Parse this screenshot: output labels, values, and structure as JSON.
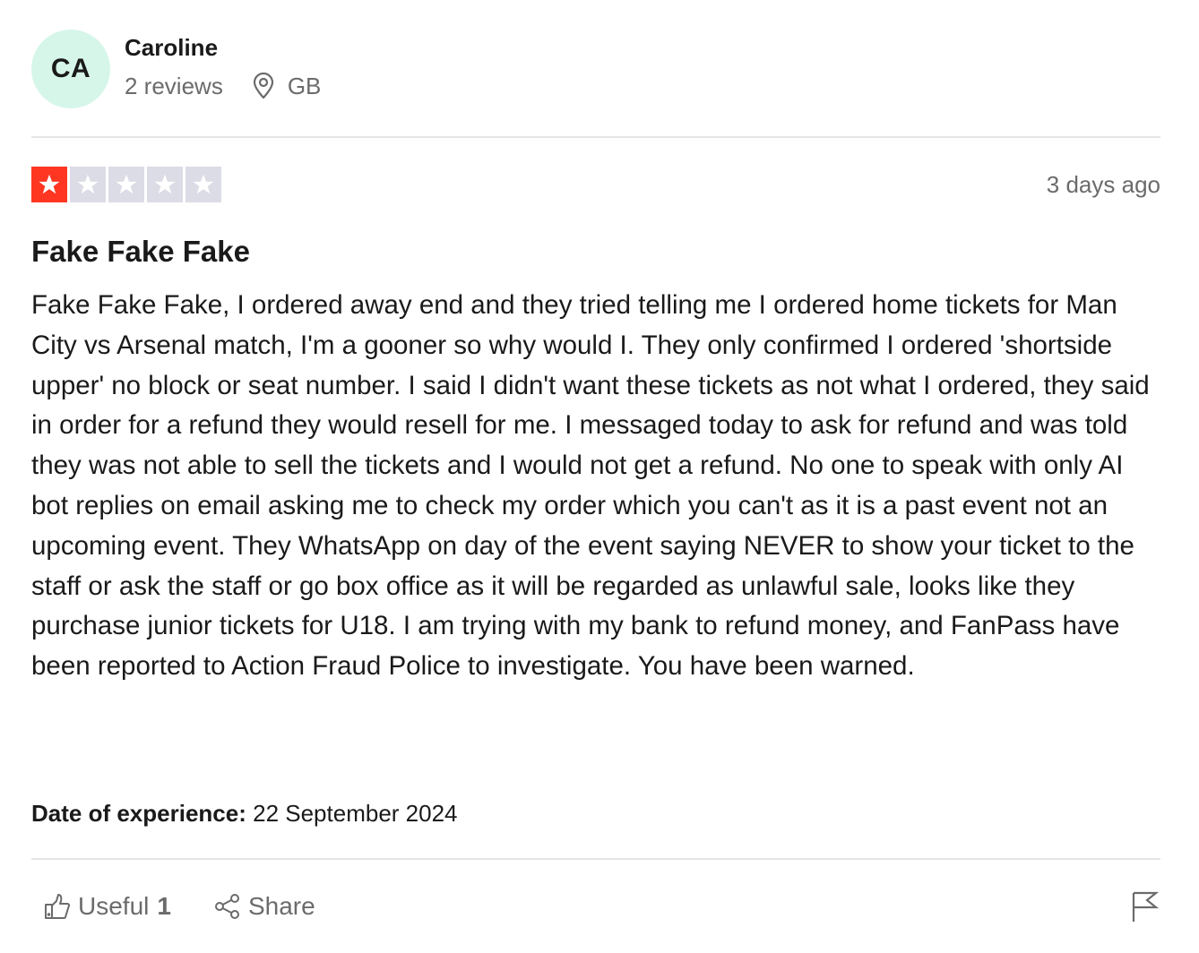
{
  "consumer": {
    "initials": "CA",
    "name": "Caroline",
    "reviews_count": "2 reviews",
    "location": "GB",
    "location_icon": "map-pin-icon"
  },
  "review": {
    "rating": 1,
    "max_rating": 5,
    "rating_color": "#ff3722",
    "empty_star_color": "#dcdce6",
    "posted": "3 days ago",
    "title": "Fake Fake Fake",
    "body": "Fake Fake Fake, I ordered away end and they tried telling me I ordered home tickets for Man City vs Arsenal match, I'm a gooner so why would I. They only confirmed I ordered 'shortside upper' no block or seat number. I said I didn't want these tickets as not what I ordered, they said in order for a refund they would resell for me. I messaged today to ask for refund and was told they was not able to sell the tickets and I would not get a refund. No one to speak with only AI bot replies on email asking me to check my order which you can't as it is a past event not an upcoming event. They WhatsApp on day of the event saying NEVER to show your ticket to the staff or ask the staff or go box office as it will be regarded as unlawful sale, looks like they purchase junior tickets for U18. I am trying with my bank to refund money, and FanPass have been reported to Action Fraud Police to investigate. You have been warned.",
    "experience_label": "Date of experience:",
    "experience_date": "22 September 2024"
  },
  "actions": {
    "useful_label": "Useful",
    "useful_count": "1",
    "useful_icon": "thumbs-up-icon",
    "share_label": "Share",
    "share_icon": "share-icon",
    "report_icon": "flag-icon"
  },
  "colors": {
    "avatar_bg": "#d6f6ea",
    "text_primary": "#1a1a1a",
    "text_secondary": "#6b6b6b",
    "divider": "#e5e5e5"
  }
}
